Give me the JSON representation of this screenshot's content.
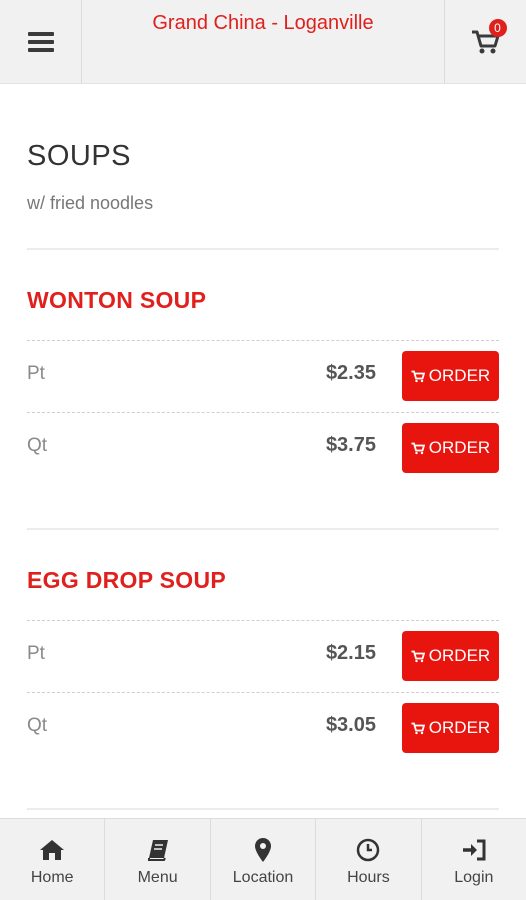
{
  "header": {
    "title": "Grand China - Loganville",
    "cart_count": "0",
    "menu_icon": "hamburger-icon",
    "cart_icon": "cart-icon"
  },
  "category": {
    "title": "SOUPS",
    "description": "w/ fried noodles"
  },
  "items": [
    {
      "name": "WONTON SOUP",
      "sizes": [
        {
          "label": "Pt",
          "price": "$2.35",
          "button": "ORDER"
        },
        {
          "label": "Qt",
          "price": "$3.75",
          "button": "ORDER"
        }
      ]
    },
    {
      "name": "EGG DROP SOUP",
      "sizes": [
        {
          "label": "Pt",
          "price": "$2.15",
          "button": "ORDER"
        },
        {
          "label": "Qt",
          "price": "$3.05",
          "button": "ORDER"
        }
      ]
    }
  ],
  "bottom_nav": [
    {
      "label": "Home",
      "icon": "home-icon"
    },
    {
      "label": "Menu",
      "icon": "book-icon"
    },
    {
      "label": "Location",
      "icon": "map-pin-icon"
    },
    {
      "label": "Hours",
      "icon": "clock-icon"
    },
    {
      "label": "Login",
      "icon": "sign-in-icon"
    }
  ],
  "colors": {
    "accent": "#e0201c",
    "button": "#e8150f",
    "bar_background": "#f1f1f1"
  }
}
